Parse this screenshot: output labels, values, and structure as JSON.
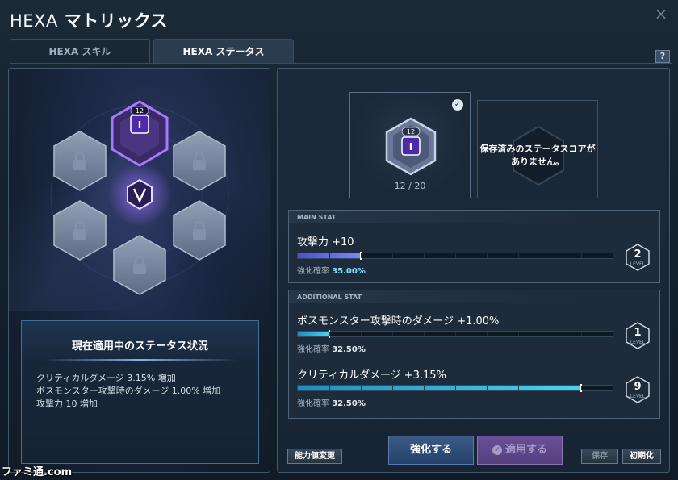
{
  "window": {
    "title_prefix": "HEXA",
    "title_suffix": " マトリックス",
    "close_label": "×"
  },
  "tabs": [
    {
      "label": "HEXA スキル",
      "active": false
    },
    {
      "label": "HEXA ステータス",
      "active": true
    }
  ],
  "help_label": "?",
  "hex_grid": {
    "active_core": {
      "level_text": "12",
      "glyph": "I"
    },
    "locked_slots": 5,
    "center_icon": "v-emblem-icon",
    "accent_color": "#8a5cff"
  },
  "status_panel": {
    "title": "現在適用中のステータス状況",
    "lines": [
      "クリティカルダメージ 3.15% 増加",
      "ボスモンスター攻撃時のダメージ 1.00% 増加",
      "攻撃力 10 増加"
    ]
  },
  "core_card": {
    "level_text": "12",
    "glyph": "I",
    "progress": "12 / 20",
    "checked": true
  },
  "saved_card": {
    "line1": "保存済みのステータスコアが",
    "line2": "ありません。"
  },
  "main_stat": {
    "header": "MAIN STAT",
    "name": "攻撃力 +10",
    "rate_label": "強化確率",
    "rate_value": "35.00%",
    "fill_fraction": 0.2,
    "level": "2",
    "level_caption": "LEVEL"
  },
  "additional_stat": {
    "header": "ADDITIONAL STAT",
    "items": [
      {
        "name": "ボスモンスター攻撃時のダメージ +1.00%",
        "rate_label": "強化確率",
        "rate_value": "32.50%",
        "fill_fraction": 0.1,
        "level": "1",
        "level_caption": "LEVEL"
      },
      {
        "name": "クリティカルダメージ +3.15%",
        "rate_label": "強化確率",
        "rate_value": "32.50%",
        "fill_fraction": 0.9,
        "level": "9",
        "level_caption": "LEVEL"
      }
    ]
  },
  "buttons": {
    "change_stat": "能力値変更",
    "enhance": "強化する",
    "apply": "適用する",
    "save": "保存",
    "reset": "初期化"
  },
  "watermark": "ファミ通.com"
}
